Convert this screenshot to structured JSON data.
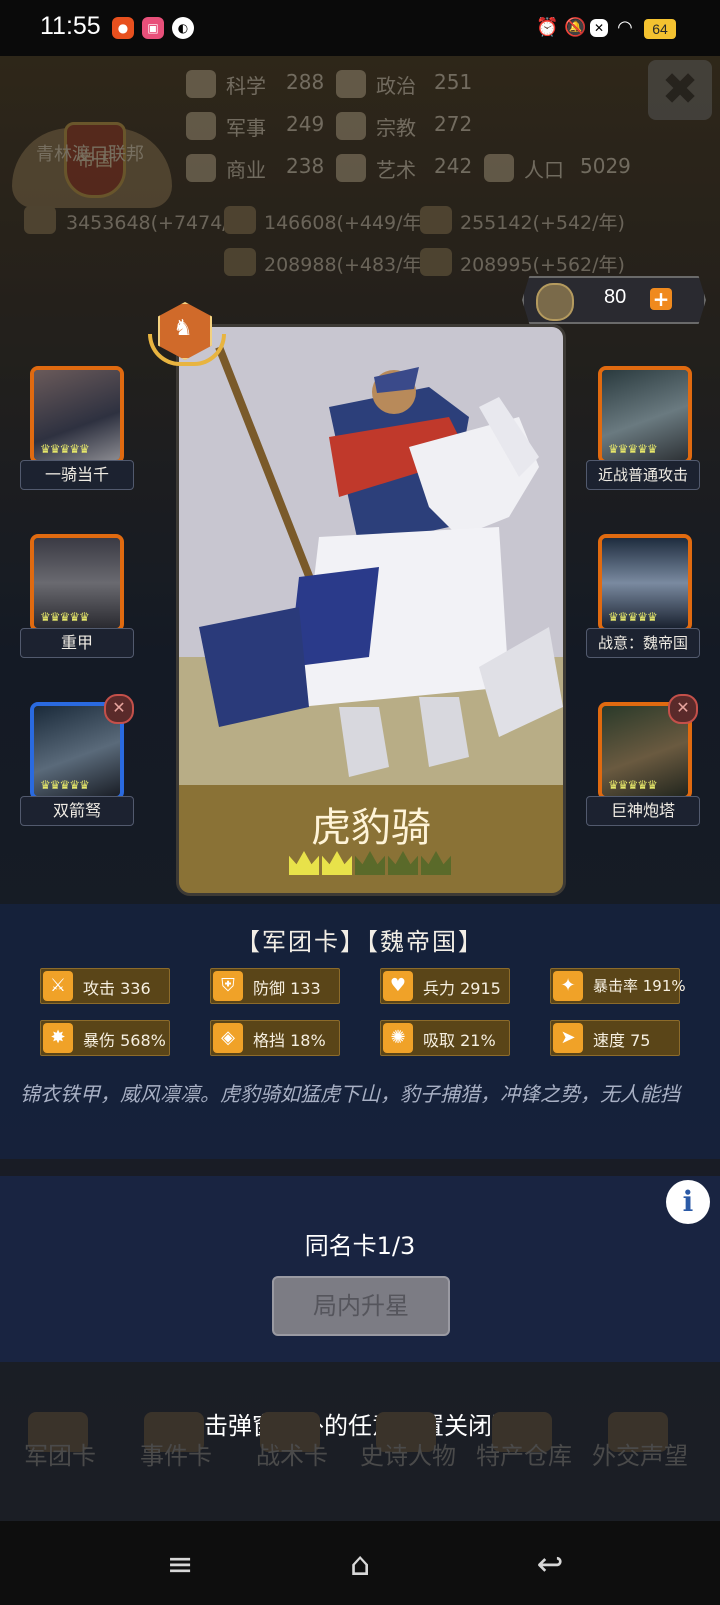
{
  "status_bar": {
    "time": "11:55",
    "battery": "64",
    "left_icons": [
      "app-icon-orange",
      "app-icon-pink",
      "app-icon-white"
    ],
    "right_icons": [
      "alarm-icon",
      "mute-icon",
      "close-box-icon",
      "wifi-icon"
    ]
  },
  "header": {
    "emblem_text": "帝国",
    "empire_name": "青林渡口联邦",
    "stats": [
      {
        "label": "科学",
        "value": "288",
        "icon": "science-icon"
      },
      {
        "label": "政治",
        "value": "251",
        "icon": "politics-icon"
      },
      {
        "label": "军事",
        "value": "249",
        "icon": "military-icon"
      },
      {
        "label": "宗教",
        "value": "272",
        "icon": "religion-icon"
      },
      {
        "label": "商业",
        "value": "238",
        "icon": "commerce-icon"
      },
      {
        "label": "艺术",
        "value": "242",
        "icon": "art-icon"
      },
      {
        "label": "人口",
        "value": "5029",
        "icon": "population-icon"
      }
    ],
    "resources": [
      "3453648(+7474/年",
      "146608(+449/年)",
      "255142(+542/年)",
      "208988(+483/年",
      "208995(+562/年)"
    ]
  },
  "currency": {
    "value": "80",
    "plus": "+"
  },
  "skills_left": [
    {
      "label": "一骑当千",
      "crowns": "♛♛♛♛♛",
      "frame": "orange",
      "removable": false
    },
    {
      "label": "重甲",
      "crowns": "♛♛♛♛♛",
      "frame": "orange",
      "removable": false
    },
    {
      "label": "双箭驽",
      "crowns": "♛♛♛♛♛",
      "frame": "blue",
      "removable": true
    }
  ],
  "skills_right": [
    {
      "label": "近战普通攻击",
      "crowns": "♛♛♛♛♛",
      "frame": "orange",
      "removable": false
    },
    {
      "label": "战意：魏帝国",
      "crowns": "♛♛♛♛♛",
      "frame": "orange",
      "removable": false
    },
    {
      "label": "巨神炮塔",
      "crowns": "♛♛♛♛♛",
      "frame": "orange",
      "removable": true
    }
  ],
  "card": {
    "name": "虎豹骑",
    "stars_filled": 2,
    "stars_total": 5
  },
  "info": {
    "tags": "【军团卡】【魏帝国】",
    "stats": [
      {
        "icon": "sword-icon",
        "text": "攻击 336"
      },
      {
        "icon": "shield-icon",
        "text": "防御 133"
      },
      {
        "icon": "heart-icon",
        "text": "兵力 2915"
      },
      {
        "icon": "crit-rate-icon",
        "text": "暴击率 191%"
      },
      {
        "icon": "crit-damage-icon",
        "text": "暴伤 568%"
      },
      {
        "icon": "block-icon",
        "text": "格挡 18%"
      },
      {
        "icon": "lifesteal-icon",
        "text": "吸取 21%"
      },
      {
        "icon": "speed-icon",
        "text": "速度 75"
      }
    ],
    "description": "锦衣铁甲，威风凛凛。虎豹骑如猛虎下山，豹子捕猎，冲锋之势，无人能挡"
  },
  "lower": {
    "dup_count": "同名卡1/3",
    "upgrade_button": "局内升星",
    "info_glyph": "i"
  },
  "hint": "点击弹窗以外的任意位置关闭弹窗",
  "tabs": [
    "军团卡",
    "事件卡",
    "战术卡",
    "史诗人物",
    "特产仓库",
    "外交声望"
  ],
  "navbar": {
    "menu": "≡",
    "home": "⌂",
    "back": "↩"
  }
}
